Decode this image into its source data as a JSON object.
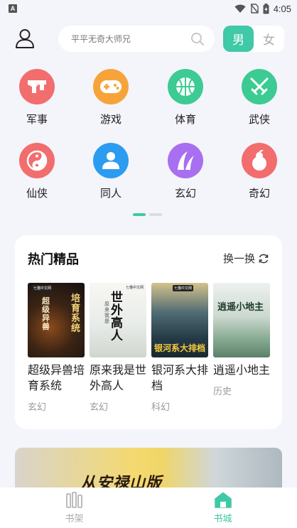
{
  "status_bar": {
    "time": "4:05",
    "app_badge": "A"
  },
  "header": {
    "search_placeholder": "平平无奇大师兄",
    "gender": {
      "male": "男",
      "female": "女",
      "selected": "male"
    }
  },
  "categories": [
    {
      "label": "军事",
      "icon": "gun-icon",
      "color": "#f26d6d"
    },
    {
      "label": "游戏",
      "icon": "gamepad-icon",
      "color": "#f6a43a"
    },
    {
      "label": "体育",
      "icon": "basketball-icon",
      "color": "#3ccb92"
    },
    {
      "label": "武侠",
      "icon": "crossed-swords-icon",
      "color": "#3ccb92"
    },
    {
      "label": "仙侠",
      "icon": "yin-yang-icon",
      "color": "#f26d6d"
    },
    {
      "label": "同人",
      "icon": "person-icon",
      "color": "#2b9cf0"
    },
    {
      "label": "玄幻",
      "icon": "claw-icon",
      "color": "#a86ff0"
    },
    {
      "label": "奇幻",
      "icon": "gourd-icon",
      "color": "#f26d6d"
    }
  ],
  "pager": {
    "active_index": 0,
    "count": 2
  },
  "hot": {
    "title": "热门精品",
    "refresh_label": "换一换",
    "books": [
      {
        "title": "超级异兽培育系统",
        "genre": "玄幻",
        "cover_text": "培育系统",
        "cover_text2": "超级异兽",
        "publisher": "七猫中文网"
      },
      {
        "title": "原来我是世外高人",
        "genre": "玄幻",
        "cover_text": "世外高人",
        "cover_text2": "原来我是",
        "publisher": "七猫中文网"
      },
      {
        "title": "银河系大排档",
        "genre": "科幻",
        "cover_text": "银河系大排档",
        "cover_text2": "",
        "publisher": "七猫中文网"
      },
      {
        "title": "逍遥小地主",
        "genre": "历史",
        "cover_text": "逍遥小地主",
        "cover_text2": "",
        "publisher": ""
      }
    ]
  },
  "banner": {
    "text": "从安禄山版"
  },
  "bottom_nav": [
    {
      "label": "书架",
      "icon": "bookshelf-icon",
      "active": false
    },
    {
      "label": "书城",
      "icon": "home-icon",
      "active": true
    }
  ],
  "colors": {
    "accent": "#3fc9a6",
    "background": "#f4f4fb"
  }
}
